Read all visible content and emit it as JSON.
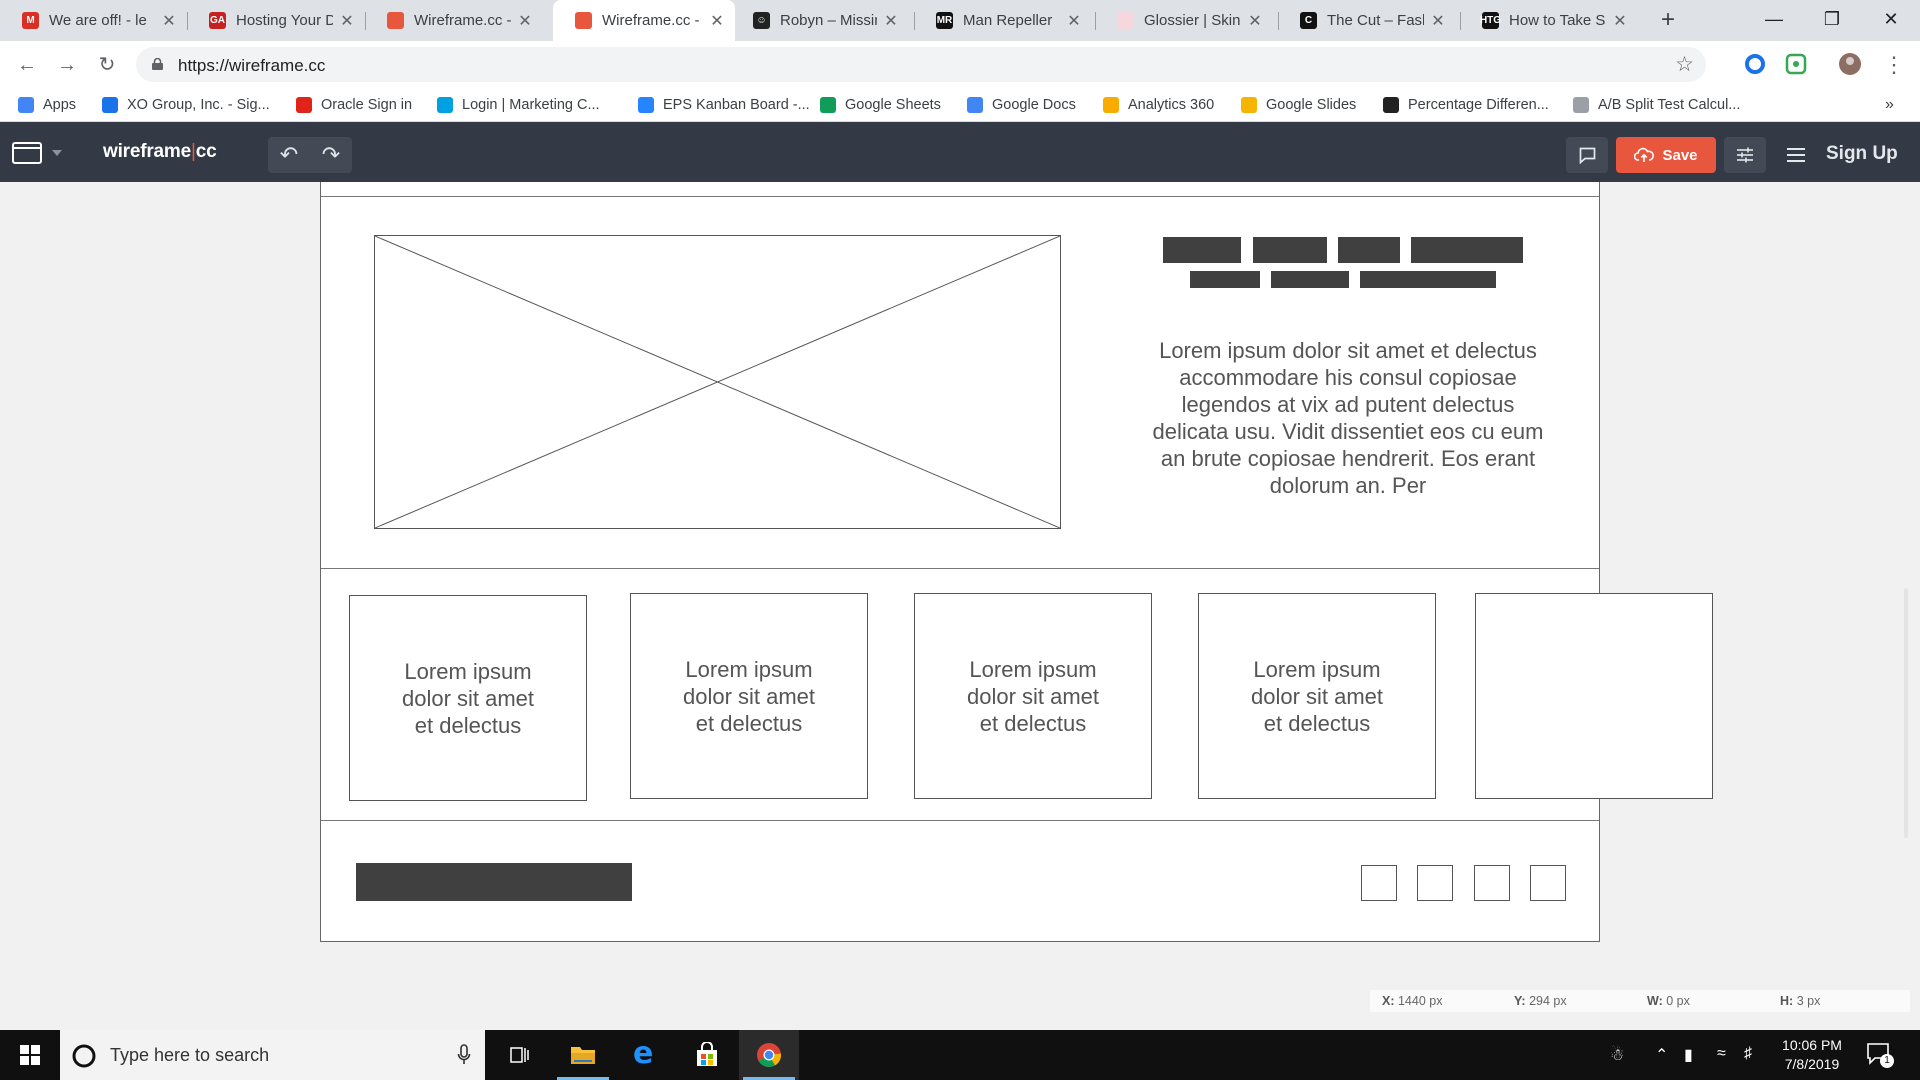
{
  "browser": {
    "tabs": [
      {
        "title": "We are off! - le",
        "favicon": "gmail-icon",
        "color": "#d93025",
        "glyph": "M",
        "active": false
      },
      {
        "title": "Hosting Your D",
        "favicon": "ga-icon",
        "color": "#c5221f",
        "glyph": "GA",
        "active": false
      },
      {
        "title": "Wireframe.cc -",
        "favicon": "wireframe-icon",
        "color": "#e9563e",
        "glyph": "",
        "active": false
      },
      {
        "title": "Wireframe.cc -",
        "favicon": "wireframe-icon",
        "color": "#e9563e",
        "glyph": "",
        "active": true
      },
      {
        "title": "Robyn – Missin",
        "favicon": "robyn-icon",
        "color": "#222222",
        "glyph": "☺",
        "active": false
      },
      {
        "title": "Man Repeller",
        "favicon": "manrepeller-icon",
        "color": "#111111",
        "glyph": "MR",
        "active": false
      },
      {
        "title": "Glossier | Skinc",
        "favicon": "glossier-icon",
        "color": "#f6d7dc",
        "glyph": "",
        "active": false
      },
      {
        "title": "The Cut – Fashi",
        "favicon": "thecut-icon",
        "color": "#111111",
        "glyph": "C",
        "active": false
      },
      {
        "title": "How to Take Sc",
        "favicon": "htg-icon",
        "color": "#111111",
        "glyph": "HTG",
        "active": false
      }
    ],
    "new_tab": "+",
    "url": "https://wireframe.cc",
    "bookmarks": [
      {
        "label": "Apps",
        "icon": "apps-grid-icon",
        "color": "#4285f4"
      },
      {
        "label": "XO Group, Inc. - Sig...",
        "icon": "xo-icon",
        "color": "#1a73e8"
      },
      {
        "label": "Oracle Sign in",
        "icon": "oracle-icon",
        "color": "#e2231a"
      },
      {
        "label": "Login | Marketing C...",
        "icon": "salesforce-icon",
        "color": "#00a1e0"
      },
      {
        "label": "EPS Kanban Board -...",
        "icon": "jira-icon",
        "color": "#2684ff"
      },
      {
        "label": "Google Sheets",
        "icon": "sheets-icon",
        "color": "#0f9d58"
      },
      {
        "label": "Google Docs",
        "icon": "docs-icon",
        "color": "#4285f4"
      },
      {
        "label": "Analytics 360",
        "icon": "analytics-icon",
        "color": "#f9ab00"
      },
      {
        "label": "Google Slides",
        "icon": "slides-icon",
        "color": "#f4b400"
      },
      {
        "label": "Percentage Differen...",
        "icon": "sigma-icon",
        "color": "#222222"
      },
      {
        "label": "A/B Split Test Calcul...",
        "icon": "abtest-icon",
        "color": "#9aa0a6"
      }
    ],
    "more_bookmarks": "»"
  },
  "app": {
    "logo_main": "wireframe",
    "logo_bar": "|",
    "logo_suffix": "cc",
    "save_label": "Save",
    "signup_label": "Sign Up"
  },
  "wireframe": {
    "paragraph": "Lorem ipsum dolor sit amet et delectus accommodare his consul copiosae legendos at vix ad putent delectus delicata usu. Vidit dissentiet eos cu eum an brute copiosae hendrerit. Eos erant dolorum an. Per",
    "cards": [
      "Lorem ipsum dolor sit amet et delectus",
      "Lorem ipsum dolor sit amet et delectus",
      "Lorem ipsum dolor sit amet et delectus",
      "Lorem ipsum dolor sit amet et delectus",
      ""
    ]
  },
  "readout": {
    "x_label": "X:",
    "x_value": "1440 px",
    "y_label": "Y:",
    "y_value": "294 px",
    "w_label": "W:",
    "w_value": "0 px",
    "h_label": "H:",
    "h_value": "3 px"
  },
  "taskbar": {
    "search_placeholder": "Type here to search",
    "time": "10:06 PM",
    "date": "7/8/2019",
    "notification_count": "1"
  }
}
